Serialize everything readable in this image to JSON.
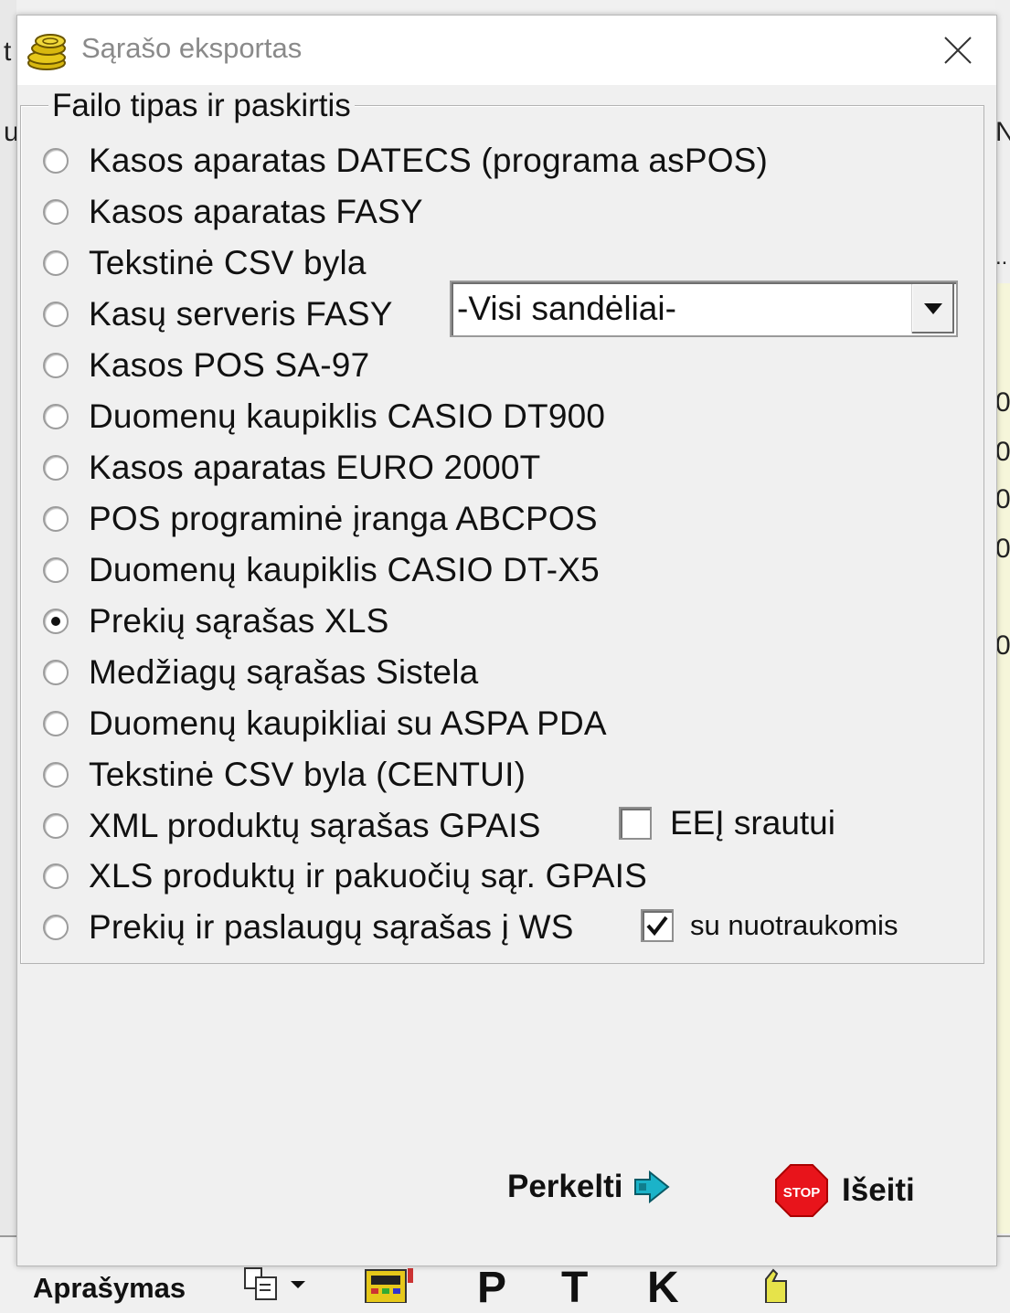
{
  "dialog": {
    "title": "Sąrašo eksportas",
    "title_icon": "coins-icon",
    "close_icon": "close-icon"
  },
  "group": {
    "legend": "Failo tipas ir paskirtis",
    "options": [
      {
        "label": "Kasos aparatas DATECS (programa asPOS)",
        "checked": false
      },
      {
        "label": "Kasos aparatas FASY",
        "checked": false
      },
      {
        "label": "Tekstinė CSV byla",
        "checked": false
      },
      {
        "label": "Kasų serveris FASY",
        "checked": false
      },
      {
        "label": "Kasos POS SA-97",
        "checked": false
      },
      {
        "label": "Duomenų kaupiklis CASIO DT900",
        "checked": false
      },
      {
        "label": "Kasos aparatas EURO 2000T",
        "checked": false
      },
      {
        "label": "POS programinė įranga ABCPOS",
        "checked": false
      },
      {
        "label": "Duomenų kaupiklis CASIO DT-X5",
        "checked": false
      },
      {
        "label": "Prekių sąrašas XLS",
        "checked": true
      },
      {
        "label": "Medžiagų sąrašas Sistela",
        "checked": false
      },
      {
        "label": "Duomenų kaupikliai su ASPA PDA",
        "checked": false
      },
      {
        "label": "Tekstinė CSV byla (CENTUI)",
        "checked": false
      },
      {
        "label": "XML produktų sąrašas GPAIS",
        "checked": false
      },
      {
        "label": "XLS produktų ir pakuočių sąr. GPAIS",
        "checked": false
      },
      {
        "label": "Prekių ir paslaugų sąrašas į WS",
        "checked": false
      }
    ],
    "warehouse_select": {
      "value": "-Visi sandėliai-"
    },
    "eei_checkbox": {
      "label": "EEĮ srautui",
      "checked": false
    },
    "photos_checkbox": {
      "label": "su nuotraukomis",
      "checked": true
    }
  },
  "buttons": {
    "transfer": {
      "label": "Perkelti",
      "icon": "arrow-right-icon"
    },
    "exit": {
      "label": "Išeiti",
      "icon": "stop-sign-icon"
    }
  },
  "background": {
    "left_chars": [
      "t",
      "u"
    ],
    "right_chars": [
      "N",
      "..",
      "0",
      "0",
      "0",
      "0",
      "0"
    ],
    "column_header": "Aprašymas",
    "toolbar_letters": [
      "P",
      "T",
      "K"
    ]
  },
  "colors": {
    "stop_red": "#e8141b",
    "arrow_cyan": "#1bb3c9",
    "coin_yellow": "#e6c81a"
  }
}
